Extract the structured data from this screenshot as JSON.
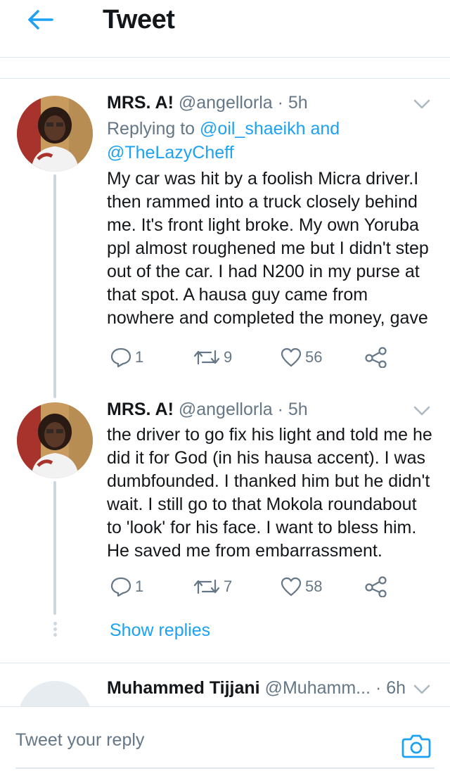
{
  "header": {
    "title": "Tweet",
    "back_icon": "arrow-left-icon"
  },
  "colors": {
    "accent": "#1da1f2",
    "text": "#14171a",
    "muted": "#657786",
    "border": "#e1e8ed",
    "thread_line": "#ccd6dd"
  },
  "tweets": [
    {
      "name": "MRS. A!",
      "handle": "@angellorla",
      "separator": "·",
      "time": "5h",
      "replying_prefix": "Replying to ",
      "replying_user1": "@oil_shaeikh",
      "replying_and": " and",
      "replying_user2": "@TheLazyCheff",
      "lines": [
        "My car was hit by a foolish Micra driver.I",
        "then rammed into a truck closely behind",
        "me. It's front light broke. My own Yoruba",
        "ppl almost roughened me but I didn't step",
        "out of the car. I had N200 in my purse at",
        "that spot. A hausa guy came from",
        "nowhere and completed the money, gave"
      ],
      "replies": "1",
      "retweets": "9",
      "likes": "56"
    },
    {
      "name": "MRS. A!",
      "handle": "@angellorla",
      "separator": "·",
      "time": "5h",
      "lines": [
        "the driver to go fix his light and told me he",
        "did it for God (in his hausa accent). I was",
        "dumbfounded. I thanked him but he didn't",
        "wait. I still go to that Mokola roundabout",
        "to 'look' for his face. I want to bless him.",
        "He saved me from embarrassment."
      ],
      "replies": "1",
      "retweets": "7",
      "likes": "58"
    }
  ],
  "show_replies": "Show replies",
  "next_tweet": {
    "name": "Muhammed Tijjani",
    "handle": "@Muhamm...",
    "separator": "·",
    "time": "6h"
  },
  "composer": {
    "placeholder": "Tweet your reply",
    "camera_icon": "camera-icon"
  }
}
